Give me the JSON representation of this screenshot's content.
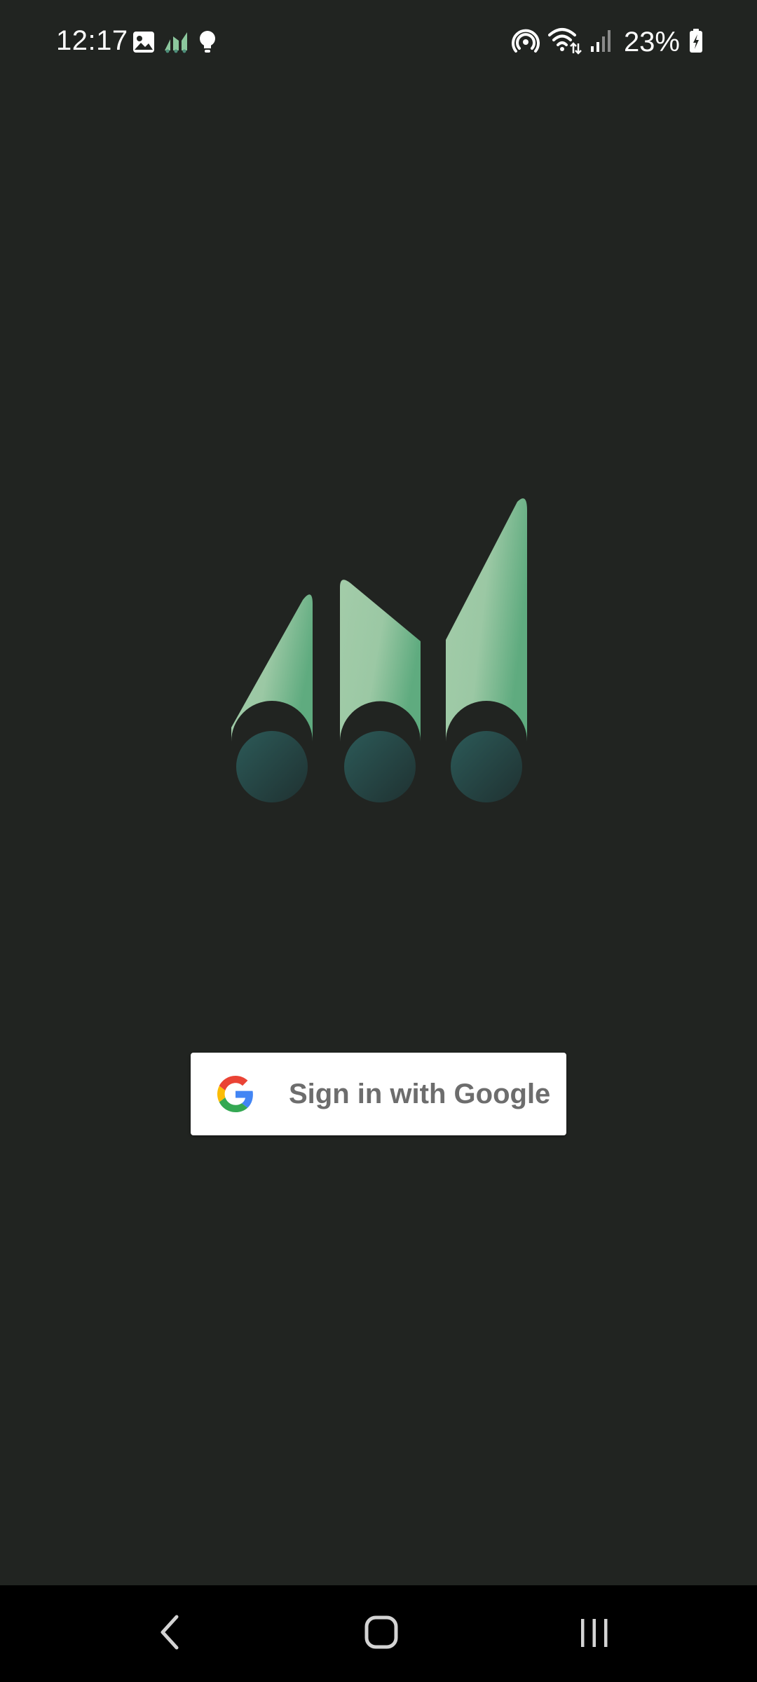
{
  "status_bar": {
    "time": "12:17",
    "battery_percent": "23%",
    "left_icons": [
      "gallery-icon",
      "app-logo-notification-icon",
      "lightbulb-icon"
    ],
    "right_icons": [
      "hotspot-icon",
      "wifi-icon",
      "cell-signal-icon",
      "battery-charging-icon"
    ]
  },
  "logo": {
    "name": "app-logo",
    "colors": {
      "bar_light": "#a3cca9",
      "bar_dark": "#63ad80",
      "circle_light": "#2b5555",
      "circle_dark": "#213434"
    }
  },
  "sign_in": {
    "label": "Sign in with Google",
    "icon": "google-g-icon"
  },
  "nav_bar": {
    "buttons": [
      "back-icon",
      "home-icon",
      "recents-icon"
    ]
  },
  "colors": {
    "background": "#212421",
    "nav_background": "#000000",
    "button_background": "#ffffff",
    "button_text": "#6d6d6d"
  }
}
